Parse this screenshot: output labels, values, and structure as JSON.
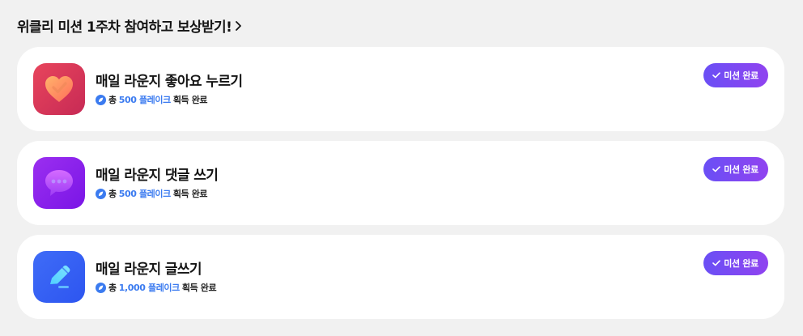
{
  "header": {
    "title": "위클리 미션 1주차 참여하고 보상받기!",
    "chevron_icon": "chevron-right-icon"
  },
  "reward_text": {
    "prefix": "총",
    "unit": "플레이크",
    "suffix": "획득 완료"
  },
  "missions": [
    {
      "title": "매일 라운지 좋아요 누르기",
      "icon": "heart-check-icon",
      "reward_amount": "500",
      "status": "미션 완료",
      "icon_colors": [
        "#e8455c",
        "#c72a55"
      ]
    },
    {
      "title": "매일 라운지 댓글 쓰기",
      "icon": "comment-bubble-icon",
      "reward_amount": "500",
      "status": "미션 완료",
      "icon_colors": [
        "#9b2ff0",
        "#7a15e6"
      ]
    },
    {
      "title": "매일 라운지 글쓰기",
      "icon": "pencil-icon",
      "reward_amount": "1,000",
      "status": "미션 완료",
      "icon_colors": [
        "#3f6cf7",
        "#2d55f0"
      ]
    }
  ],
  "colors": {
    "accent_blue": "#3b7bf0",
    "badge_start": "#6a4ff5",
    "badge_end": "#9043f0",
    "background": "#f1f1f1"
  }
}
